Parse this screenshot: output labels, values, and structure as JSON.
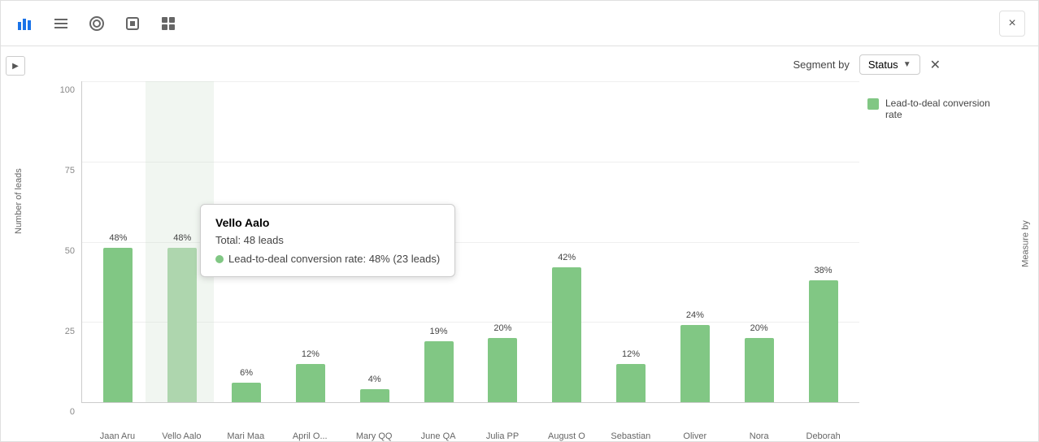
{
  "toolbar": {
    "close_label": "×",
    "icons": [
      {
        "name": "bar-chart-icon",
        "symbol": "▐▌"
      },
      {
        "name": "list-icon",
        "symbol": "≡"
      },
      {
        "name": "donut-icon",
        "symbol": "◎"
      },
      {
        "name": "table-icon",
        "symbol": "▦"
      },
      {
        "name": "grid-icon",
        "symbol": "⊞"
      }
    ]
  },
  "chart": {
    "segment_by_label": "Segment by",
    "segment_value": "Status",
    "y_axis_label": "Number of leads",
    "measure_label": "Measure by",
    "y_ticks": [
      "100",
      "75",
      "50",
      "25",
      "0"
    ],
    "legend": {
      "color": "#81c784",
      "label": "Lead-to-deal conversion rate"
    },
    "bars": [
      {
        "name": "Jaan Aru",
        "pct": "48%",
        "height_pct": 48
      },
      {
        "name": "Vello Aalo",
        "pct": "48%",
        "height_pct": 48,
        "highlighted": true
      },
      {
        "name": "Mari Maa",
        "pct": "6%",
        "height_pct": 6
      },
      {
        "name": "April O...",
        "pct": "12%",
        "height_pct": 12
      },
      {
        "name": "Mary QQ",
        "pct": "4%",
        "height_pct": 4
      },
      {
        "name": "June QA",
        "pct": "19%",
        "height_pct": 19
      },
      {
        "name": "Julia PP",
        "pct": "20%",
        "height_pct": 20
      },
      {
        "name": "August O",
        "pct": "42%",
        "height_pct": 42
      },
      {
        "name": "Sebastian",
        "pct": "12%",
        "height_pct": 12
      },
      {
        "name": "Oliver",
        "pct": "24%",
        "height_pct": 24
      },
      {
        "name": "Nora",
        "pct": "20%",
        "height_pct": 20
      },
      {
        "name": "Deborah",
        "pct": "38%",
        "height_pct": 38
      }
    ],
    "tooltip": {
      "title": "Vello Aalo",
      "total": "Total: 48 leads",
      "detail": "Lead-to-deal conversion rate: 48% (23 leads)"
    }
  }
}
